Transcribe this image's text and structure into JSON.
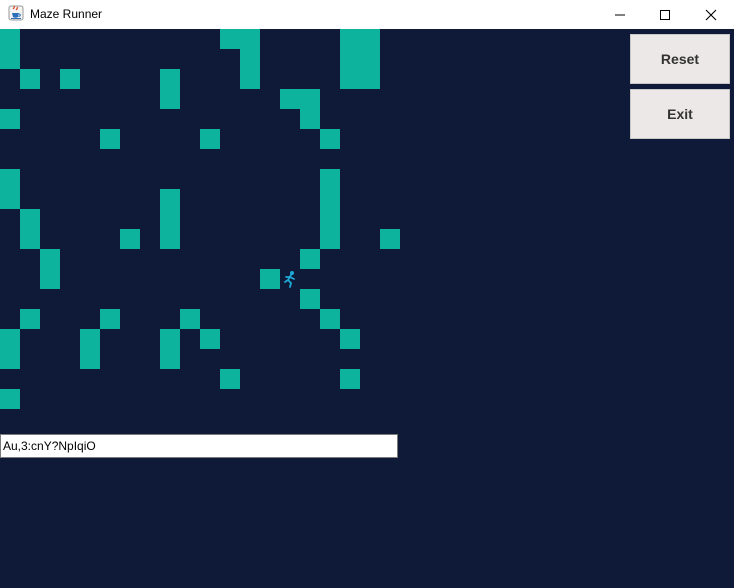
{
  "window": {
    "title": "Maze Runner",
    "app_icon": "java-cup-icon"
  },
  "controls": {
    "reset_label": "Reset",
    "exit_label": "Exit"
  },
  "code_field": {
    "value": "Au,3:cnY?NpIqiO"
  },
  "colors": {
    "background": "#0e1a38",
    "wall": "#0db39d",
    "runner": "#1fa9d6"
  },
  "maze": {
    "cols": 20,
    "rows": 20,
    "player": {
      "row": 12,
      "col": 14,
      "icon": "running-person-icon"
    },
    "wall_rows": [
      "#..........##....##.",
      "#...........#....##.",
      ".#.#....#...#....##.",
      "........#.....##....",
      "#..............#....",
      ".....#....#.....#...",
      "....................",
      "#...............#...",
      "#.......#.......#...",
      ".#......#.......#...",
      ".#....#.#.......#..#",
      "..#............#....",
      "..#..........#......",
      "...............#....",
      ".#...#...#......#...",
      "#...#...#.#......#..",
      "#...#...#...........",
      "...........#.....#..",
      "#...................",
      "...................."
    ]
  }
}
